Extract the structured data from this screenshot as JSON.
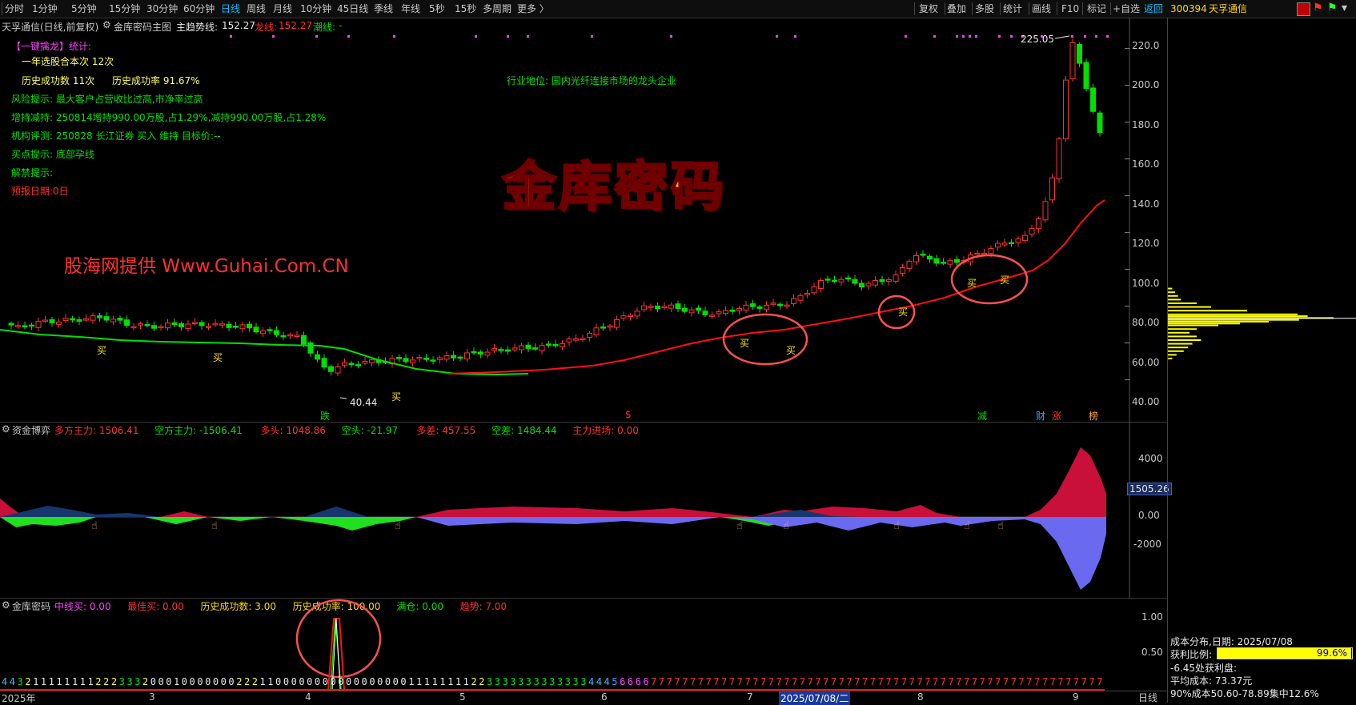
{
  "toolbar": {
    "periods": [
      "分时",
      "1分钟",
      "5分钟",
      "15分钟",
      "30分钟",
      "60分钟",
      "日线",
      "周线",
      "月线",
      "10分钟",
      "45日线",
      "季线",
      "年线",
      "5秒",
      "15秒",
      "多周期",
      "更多 〉"
    ],
    "active_period": "日线",
    "right_buttons": [
      "复权",
      "叠加",
      "多股",
      "统计",
      "画线",
      "F10",
      "标记",
      "+自选",
      "返回"
    ],
    "stock_code": "300394",
    "stock_name": "天孚通信"
  },
  "main_panel": {
    "title": "天孚通信(日线,前复权)",
    "indicator_name": "金库密码主图",
    "trend_label": "主趋势线:",
    "trend_value": "152.27",
    "dragon_label": "龙线:",
    "dragon_value": "152.27",
    "tide_label": "潮线:",
    "tide_value": "-",
    "stats": {
      "header": "【一键擒龙】统计:",
      "count_line": "一年选股合本次 12次",
      "success_count": "历史成功数 11次",
      "success_rate": "历史成功率 91.67%",
      "risk": "风险提示: 最大客户占营收比过高,市净率过高",
      "holdings": "增持减持: 250814增持990.00万股,占1.29%,减持990.00万股,占1.28%",
      "rating": "机构评测: 250828 长江证券 买入 维持 目标价:--",
      "buy_hint": "买点提示: 底部孕线",
      "unlock_hint": "解禁提示:",
      "report_date": "预报日期:0日"
    },
    "industry": "行业地位: 国内光纤连接市场的龙头企业",
    "big_title": "金库密码",
    "watermark": "股海网提供 Www.Guhai.Com.CN",
    "high_label": "225.05",
    "low_label": "40.44",
    "y_ticks": [
      "220.0",
      "200.0",
      "180.0",
      "160.0",
      "140.0",
      "120.0",
      "100.0",
      "80.00",
      "60.00",
      "40.00"
    ],
    "buy_marker": "买",
    "bottom_markers": [
      "跌",
      "$",
      "减",
      "财",
      "涨",
      "榜"
    ]
  },
  "capital_panel": {
    "name": "资金博弈",
    "items": [
      {
        "label": "多方主力:",
        "value": "1506.41",
        "color": "#ff3030"
      },
      {
        "label": "空方主力:",
        "value": "-1506.41",
        "color": "#00e000"
      },
      {
        "label": "多头:",
        "value": "1048.86",
        "color": "#ff3030"
      },
      {
        "label": "空头:",
        "value": "-21.97",
        "color": "#00e000"
      },
      {
        "label": "多差:",
        "value": "457.55",
        "color": "#ff3030"
      },
      {
        "label": "空差:",
        "value": "1484.44",
        "color": "#00e000"
      },
      {
        "label": "主力进场:",
        "value": "0.00",
        "color": "#ff3030"
      }
    ],
    "y_ticks": [
      "4000",
      "0.00",
      "-2000"
    ],
    "current_value": "1505.26"
  },
  "code_panel": {
    "name": "金库密码",
    "items": [
      {
        "label": "中线买:",
        "value": "0.00",
        "color": "#ff40ff"
      },
      {
        "label": "最佳买:",
        "value": "0.00",
        "color": "#ff3030"
      },
      {
        "label": "历史成功数:",
        "value": "3.00",
        "color": "#ffd800"
      },
      {
        "label": "历史成功率:",
        "value": "100.00",
        "color": "#ffd800"
      },
      {
        "label": "满仓:",
        "value": "0.00",
        "color": "#00e000"
      },
      {
        "label": "趋势:",
        "value": "7.00",
        "color": "#ff3030"
      }
    ],
    "y_ticks": [
      "1.00",
      "0.50"
    ],
    "digit_row": "443211111111222333200010000000222110000000000000000011111111223333333333333444566667777777777777777777777777777777777777777777777777777777777"
  },
  "x_axis": {
    "labels": [
      "2025年",
      "3",
      "4",
      "5",
      "6",
      "7",
      "2025/07/08/二",
      "8",
      "9"
    ],
    "period": "日线"
  },
  "cost_panel": {
    "title": "成本分布,日期: 2025/07/08",
    "profit_label": "获利比例:",
    "profit_value": "99.6%",
    "profit_pct": 0.996,
    "profit_line": "-6.45处获利盘:",
    "avg_cost": "平均成本: 73.37元",
    "concentration": "90%成本50.60-78.89集中12.6%"
  },
  "colors": {
    "up": "#ff3030",
    "down": "#00e000",
    "dragon": "#ff1010",
    "green_line": "#00e000",
    "chip": "#ffff00",
    "accent": "#00c0ff"
  }
}
